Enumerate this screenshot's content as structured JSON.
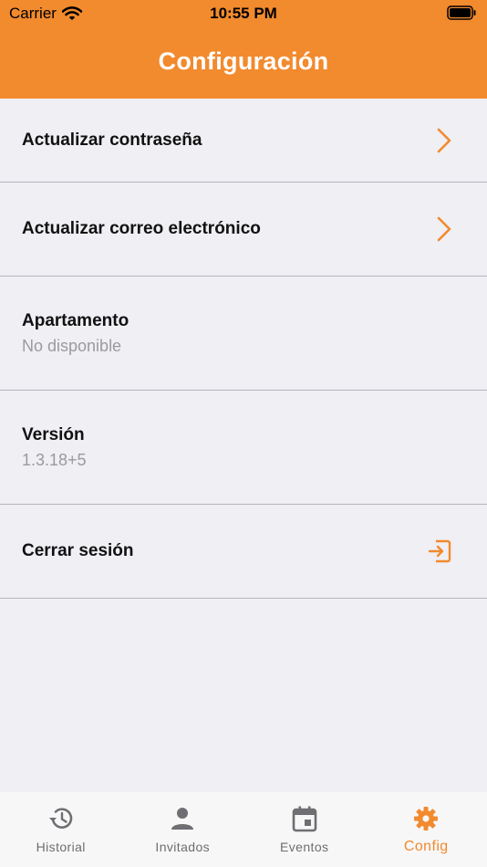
{
  "status": {
    "carrier": "Carrier",
    "time": "10:55 PM"
  },
  "header": {
    "title": "Configuración"
  },
  "settings": {
    "update_password": "Actualizar contraseña",
    "update_email": "Actualizar correo electrónico",
    "apartment_label": "Apartamento",
    "apartment_value": "No disponible",
    "version_label": "Versión",
    "version_value": "1.3.18+5",
    "logout": "Cerrar sesión"
  },
  "tabs": [
    {
      "label": "Historial",
      "icon": "history-icon"
    },
    {
      "label": "Invitados",
      "icon": "person-icon"
    },
    {
      "label": "Eventos",
      "icon": "calendar-icon"
    },
    {
      "label": "Config",
      "icon": "gear-icon"
    }
  ],
  "colors": {
    "accent": "#f28a2e",
    "background": "#efeff4",
    "inactive_tab": "#6e6e73"
  }
}
